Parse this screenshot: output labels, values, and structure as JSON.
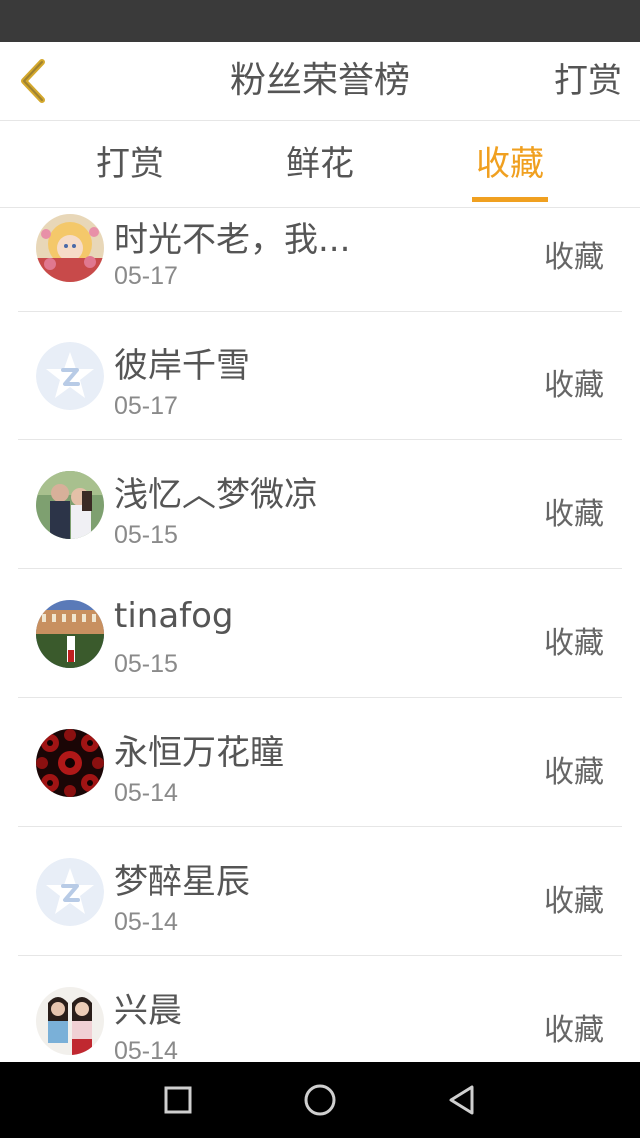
{
  "header": {
    "title": "粉丝荣誉榜",
    "action_label": "打赏"
  },
  "tabs": [
    {
      "label": "打赏",
      "active": false
    },
    {
      "label": "鲜花",
      "active": false
    },
    {
      "label": "收藏",
      "active": true
    }
  ],
  "colors": {
    "accent": "#f0a020",
    "text": "#555555",
    "status_bar": "#3a3a3a",
    "nav_bar": "#000000"
  },
  "fans": [
    {
      "name": "时光不老，我...",
      "date": "05-17",
      "type": "收藏",
      "avatar": "anime-avatar"
    },
    {
      "name": "彼岸千雪",
      "date": "05-17",
      "type": "收藏",
      "avatar": "default-avatar"
    },
    {
      "name": "浅忆︿梦微凉",
      "date": "05-15",
      "type": "收藏",
      "avatar": "couple-photo-avatar"
    },
    {
      "name": "tinafog",
      "date": "05-15",
      "type": "收藏",
      "avatar": "building-photo-avatar"
    },
    {
      "name": "永恒万花瞳",
      "date": "05-14",
      "type": "收藏",
      "avatar": "sharingan-avatar"
    },
    {
      "name": "梦醉星辰",
      "date": "05-14",
      "type": "收藏",
      "avatar": "default-avatar"
    },
    {
      "name": "兴晨",
      "date": "05-14",
      "type": "收藏",
      "avatar": "two-girls-photo-avatar"
    }
  ],
  "nav": {
    "icons": [
      "square-recents-icon",
      "circle-home-icon",
      "triangle-back-icon"
    ]
  }
}
